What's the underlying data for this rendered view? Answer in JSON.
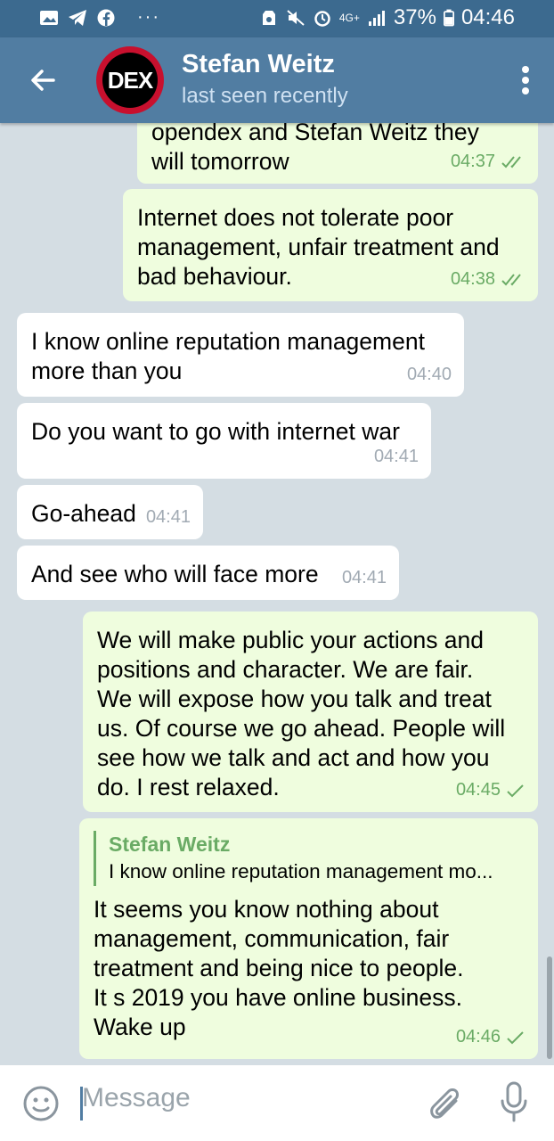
{
  "statusbar": {
    "left_icons": [
      "image-icon",
      "telegram-icon",
      "facebook-icon"
    ],
    "more": "···",
    "network": "4G+",
    "battery": "37%",
    "time": "04:46"
  },
  "header": {
    "name": "Stefan Weitz",
    "status": "last seen recently",
    "avatar_text": "DEX"
  },
  "messages": [
    {
      "dir": "out",
      "text": "opendex and Stefan Weitz they\nwill tomorrow",
      "time": "04:37",
      "ticks": "double"
    },
    {
      "dir": "out",
      "text": "Internet does not tolerate poor\nmanagement, unfair treatment and\nbad behaviour.",
      "time": "04:38",
      "ticks": "double"
    },
    {
      "dir": "in",
      "text": "I know online reputation management\nmore than you",
      "time": "04:40"
    },
    {
      "dir": "in",
      "text": "Do you want to go with internet war",
      "time": "04:41"
    },
    {
      "dir": "in",
      "text": "Go-ahead",
      "time": "04:41"
    },
    {
      "dir": "in",
      "text": "And see who will face more",
      "time": "04:41"
    },
    {
      "dir": "out",
      "text": "We will make public your actions and\npositions and character. We are fair.\nWe will expose how you talk and treat\nus. Of course we go ahead. People will\nsee how we talk and act and how you\ndo. I rest relaxed.",
      "time": "04:45",
      "ticks": "single"
    },
    {
      "dir": "out",
      "reply_name": "Stefan Weitz",
      "reply_text": "I know online reputation management mo...",
      "text": "It seems you know nothing about\nmanagement,  communication, fair\ntreatment and being nice to people.\nIt s 2019 you have online business.\nWake up",
      "time": "04:46",
      "ticks": "single"
    }
  ],
  "input": {
    "placeholder": "Message"
  },
  "colors": {
    "header": "#517da2",
    "statusbar": "#3c6a8f",
    "outgoing_bubble": "#effdde",
    "incoming_bubble": "#ffffff",
    "tick_green": "#6aab65"
  }
}
